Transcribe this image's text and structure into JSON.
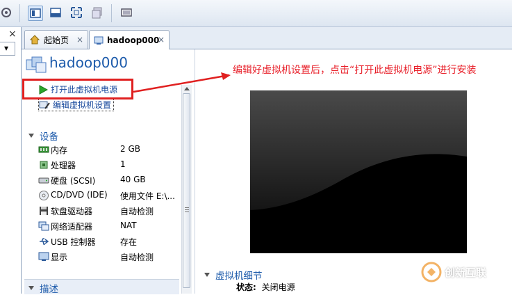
{
  "toolbar": {
    "buttons": [
      "settings-icon",
      "console-view-icon",
      "fullscreen-icon",
      "unity-icon",
      "toggle-icon",
      "thumbnail-view-icon"
    ]
  },
  "left_strip": {
    "close_glyph": "×",
    "dropdown_glyph": "▾"
  },
  "tabs": [
    {
      "label": "起始页",
      "close": "×"
    },
    {
      "label": "hadoop000",
      "close": "×"
    }
  ],
  "vm": {
    "name": "hadoop000"
  },
  "actions": {
    "power_on": "打开此虚拟机电源",
    "edit_settings": "编辑虚拟机设置"
  },
  "devices": {
    "header": "设备",
    "items": [
      {
        "name": "内存",
        "value": "2 GB"
      },
      {
        "name": "处理器",
        "value": "1"
      },
      {
        "name": "硬盘 (SCSI)",
        "value": "40 GB"
      },
      {
        "name": "CD/DVD (IDE)",
        "value": "使用文件 E:\\..."
      },
      {
        "name": "软盘驱动器",
        "value": "自动检测"
      },
      {
        "name": "网络适配器",
        "value": "NAT"
      },
      {
        "name": "USB 控制器",
        "value": "存在"
      },
      {
        "name": "显示",
        "value": "自动检测"
      }
    ]
  },
  "description": {
    "header": "描述"
  },
  "annotation": "编辑好虚拟机设置后，点击“打开此虚拟机电源”进行安装",
  "details": {
    "header": "虚拟机细节",
    "state_label": "状态:",
    "state_value": "关闭电源"
  },
  "watermark": {
    "text": "创新互联"
  },
  "colors": {
    "accent": "#1d5bab",
    "annotation_red": "#e02020",
    "play_green": "#2aa52a"
  }
}
